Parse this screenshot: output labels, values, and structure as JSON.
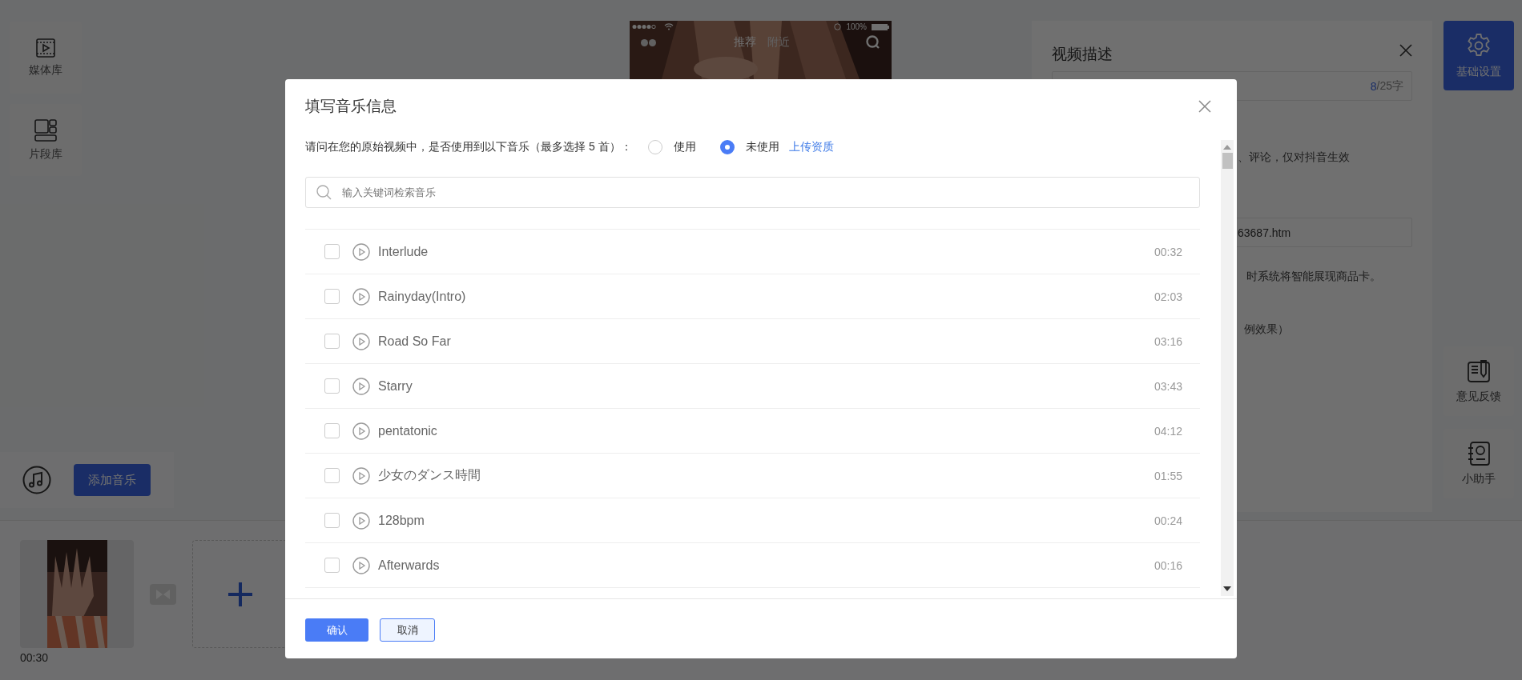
{
  "sidebar": {
    "items": [
      {
        "label": "媒体库"
      },
      {
        "label": "片段库"
      }
    ]
  },
  "music_bar": {
    "button": "添加音乐"
  },
  "phone_preview": {
    "battery": "100%",
    "tabs": [
      {
        "label": "推荐",
        "selected": true
      },
      {
        "label": "附近",
        "selected": false
      }
    ]
  },
  "timeline": {
    "clips": [
      {
        "duration": "00:30"
      }
    ]
  },
  "settings_panel": {
    "title": "视频描述",
    "counter_current": "8",
    "counter_limit": "/25字",
    "note_1": "、评论，仅对抖音生效",
    "link_value": "63687.htm",
    "note_2": "时系统将智能展现商品卡。",
    "note_3": "例效果）"
  },
  "settings_button": {
    "label": "基础设置",
    "selected": true
  },
  "rail_items": [
    {
      "label": "意见反馈",
      "selected": false
    },
    {
      "label": "小助手",
      "selected": false
    }
  ],
  "dialog": {
    "title": "填写音乐信息",
    "question": "请问在您的原始视频中，是否使用到以下音乐（最多选择 5 首）：",
    "options": [
      {
        "label": "使用",
        "selected": false
      },
      {
        "label": "未使用",
        "selected": true
      }
    ],
    "link": "上传资质",
    "search": {
      "placeholder": "输入关键词检索音乐"
    },
    "tracks": [
      {
        "title": "Interlude",
        "duration": "00:32",
        "checked": false
      },
      {
        "title": "Rainyday(Intro)",
        "duration": "02:03",
        "checked": false
      },
      {
        "title": "Road So Far",
        "duration": "03:16",
        "checked": false
      },
      {
        "title": "Starry",
        "duration": "03:43",
        "checked": false
      },
      {
        "title": "pentatonic",
        "duration": "04:12",
        "checked": false
      },
      {
        "title": "少女のダンス時間",
        "duration": "01:55",
        "checked": false
      },
      {
        "title": "128bpm",
        "duration": "00:24",
        "checked": false
      },
      {
        "title": "Afterwards",
        "duration": "00:16",
        "checked": false
      }
    ],
    "buttons": [
      {
        "label": "确认",
        "kind": "primary"
      },
      {
        "label": "取消",
        "kind": "secondary"
      }
    ]
  }
}
